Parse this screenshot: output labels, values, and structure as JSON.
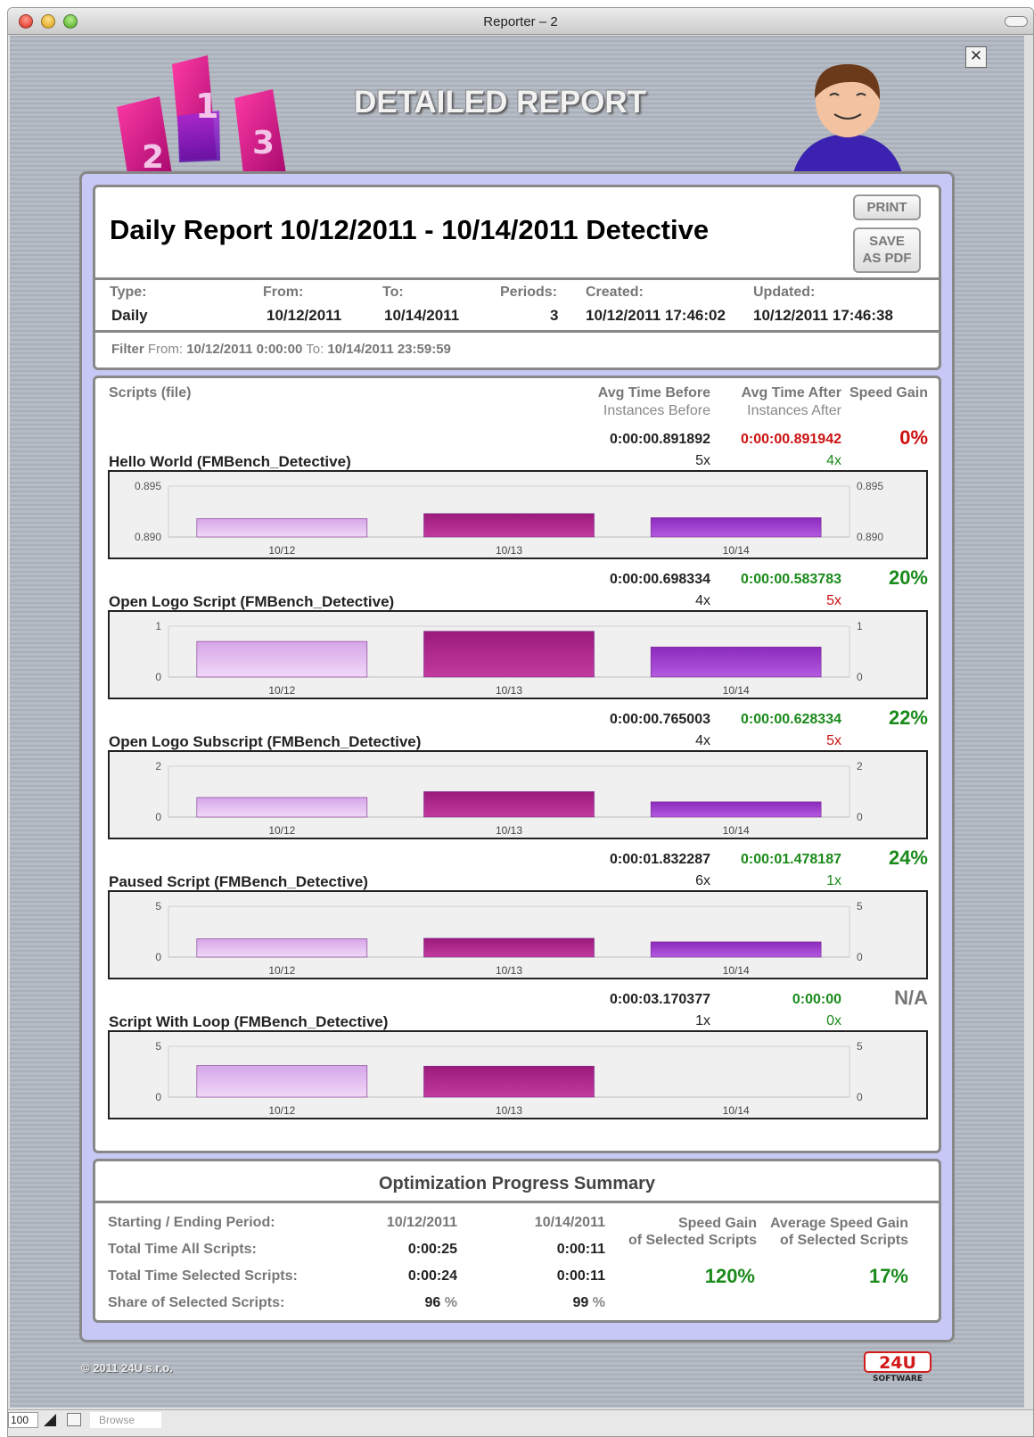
{
  "window": {
    "title": "Reporter – 2"
  },
  "header": {
    "heading": "DETAILED REPORT",
    "podium_numbers": [
      "1",
      "2",
      "3"
    ]
  },
  "report": {
    "title": "Daily Report 10/12/2011 - 10/14/2011 Detective",
    "print_label": "PRINT",
    "pdf_label_1": "SAVE",
    "pdf_label_2": "AS PDF",
    "labels": {
      "type": "Type:",
      "from": "From:",
      "to": "To:",
      "periods": "Periods:",
      "created": "Created:",
      "updated": "Updated:"
    },
    "values": {
      "type": "Daily",
      "from": "10/12/2011",
      "to": "10/14/2011",
      "periods": "3",
      "created": "10/12/2011 17:46:02",
      "updated": "10/12/2011 17:46:38"
    },
    "filter": {
      "label": "Filter",
      "from_label": "From:",
      "from_value": "10/12/2011 0:00:00",
      "to_label": "To:",
      "to_value": "10/14/2011 23:59:59"
    }
  },
  "scripts_header": {
    "col_name": "Scripts (file)",
    "col_before": "Avg Time Before",
    "col_before_sub": "Instances Before",
    "col_after": "Avg Time After",
    "col_after_sub": "Instances After",
    "col_gain": "Speed Gain"
  },
  "colors": {
    "good": "#1a8a1a",
    "bad": "#cc1111",
    "neutral": "#777777",
    "bar_1": "#d6a6e8",
    "bar_2": "#9b1a7c",
    "bar_3": "#8a2bbd"
  },
  "scripts": [
    {
      "name": "Hello World (FMBench_Detective)",
      "avg_before": "0:00:00.891892",
      "avg_after": "0:00:00.891942",
      "after_color": "bad",
      "gain": "0%",
      "gain_color": "bad",
      "inst_before": "5x",
      "inst_after": "4x",
      "inst_after_color": "good"
    },
    {
      "name": "Open Logo Script (FMBench_Detective)",
      "avg_before": "0:00:00.698334",
      "avg_after": "0:00:00.583783",
      "after_color": "good",
      "gain": "20%",
      "gain_color": "good",
      "inst_before": "4x",
      "inst_after": "5x",
      "inst_after_color": "bad"
    },
    {
      "name": "Open Logo Subscript (FMBench_Detective)",
      "avg_before": "0:00:00.765003",
      "avg_after": "0:00:00.628334",
      "after_color": "good",
      "gain": "22%",
      "gain_color": "good",
      "inst_before": "4x",
      "inst_after": "5x",
      "inst_after_color": "bad"
    },
    {
      "name": "Paused Script (FMBench_Detective)",
      "avg_before": "0:00:01.832287",
      "avg_after": "0:00:01.478187",
      "after_color": "good",
      "gain": "24%",
      "gain_color": "good",
      "inst_before": "6x",
      "inst_after": "1x",
      "inst_after_color": "good"
    },
    {
      "name": "Script With Loop (FMBench_Detective)",
      "avg_before": "0:00:03.170377",
      "avg_after": "0:00:00",
      "after_color": "good",
      "gain": "N/A",
      "gain_color": "neutral",
      "inst_before": "1x",
      "inst_after": "0x",
      "inst_after_color": "good"
    }
  ],
  "chart_data": [
    {
      "type": "bar",
      "categories": [
        "10/12",
        "10/13",
        "10/14"
      ],
      "values": [
        0.8918,
        0.8923,
        0.8919
      ],
      "ylim": [
        0.89,
        0.895
      ],
      "ytick_labels": [
        "0.890",
        "0.895"
      ],
      "grid": true
    },
    {
      "type": "bar",
      "categories": [
        "10/12",
        "10/13",
        "10/14"
      ],
      "values": [
        0.7,
        0.9,
        0.59
      ],
      "ylim": [
        0,
        1
      ],
      "ytick_labels": [
        "0",
        "1"
      ],
      "grid": true
    },
    {
      "type": "bar",
      "categories": [
        "10/12",
        "10/13",
        "10/14"
      ],
      "values": [
        0.77,
        1.0,
        0.6
      ],
      "ylim": [
        0,
        2
      ],
      "ytick_labels": [
        "0",
        "2"
      ],
      "grid": true
    },
    {
      "type": "bar",
      "categories": [
        "10/12",
        "10/13",
        "10/14"
      ],
      "values": [
        1.8,
        1.85,
        1.5
      ],
      "ylim": [
        0,
        5
      ],
      "ytick_labels": [
        "0",
        "5"
      ],
      "grid": true
    },
    {
      "type": "bar",
      "categories": [
        "10/12",
        "10/13",
        "10/14"
      ],
      "values": [
        3.1,
        3.05,
        0
      ],
      "ylim": [
        0,
        5
      ],
      "ytick_labels": [
        "0",
        "5"
      ],
      "grid": true
    }
  ],
  "summary": {
    "title": "Optimization Progress Summary",
    "rows": [
      {
        "label": "Starting / Ending Period:",
        "start": "10/12/2011",
        "end": "10/14/2011"
      },
      {
        "label": "Total Time All Scripts:",
        "start": "0:00:25",
        "end": "0:00:11"
      },
      {
        "label": "Total Time Selected Scripts:",
        "start": "0:00:24",
        "end": "0:00:11"
      },
      {
        "label": "Share of Selected Scripts:",
        "start": "96",
        "end": "99",
        "unit": "%"
      }
    ],
    "speed_gain_label_1": "Speed Gain",
    "speed_gain_label_2": "of Selected Scripts",
    "speed_gain_value": "120%",
    "avg_speed_gain_label_1": "Average Speed Gain",
    "avg_speed_gain_label_2": "of Selected Scripts",
    "avg_speed_gain_value": "17%"
  },
  "footer": {
    "copyright": "© 2011 24U s.r.o.",
    "brand": "24U",
    "brand_sub": "SOFTWARE"
  },
  "statusbar": {
    "zoom": "100",
    "mode": "Browse"
  }
}
